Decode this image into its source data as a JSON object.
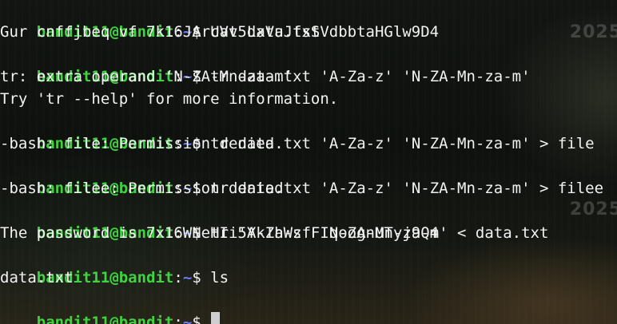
{
  "colors": {
    "user": "#3fd43f",
    "path": "#6b7bff",
    "text": "#f2f2f2"
  },
  "watermark": {
    "text": "2025"
  },
  "prompt": {
    "user_host": "bandit11@bandit",
    "sep": ":",
    "path": "~",
    "symbol": "$"
  },
  "lines": [
    {
      "type": "prompt",
      "command": "cat data.txt"
    },
    {
      "type": "output",
      "text": "Gur cnffjbeq vf 7k16JArUVv5LxVuJfsSVdbbtaHGlw9D4"
    },
    {
      "type": "prompt",
      "command": "tr data.txt 'A-Za-z' 'N-ZA-Mn-za-m'"
    },
    {
      "type": "output",
      "text": "tr: extra operand ‘N-ZA-Mn-za-m’"
    },
    {
      "type": "output",
      "text": "Try 'tr --help' for more information."
    },
    {
      "type": "prompt",
      "command": "tr data.txt 'A-Za-z' 'N-ZA-Mn-za-m' > file"
    },
    {
      "type": "output",
      "text": "-bash: file: Permission denied"
    },
    {
      "type": "prompt",
      "command": "tr data.txt 'A-Za-z' 'N-ZA-Mn-za-m' > filee"
    },
    {
      "type": "output",
      "text": "-bash: filee: Permission denied"
    },
    {
      "type": "prompt",
      "command": "tr 'A-Za-z' 'N-ZA-Mn-za-m' < data.txt"
    },
    {
      "type": "output",
      "text": "The password is 7x16WNeHIi5YkIhWsfFIqoognUTyj9Q4"
    },
    {
      "type": "prompt",
      "command": "ls"
    },
    {
      "type": "output",
      "text": "data.txt"
    },
    {
      "type": "prompt",
      "command": ""
    }
  ]
}
